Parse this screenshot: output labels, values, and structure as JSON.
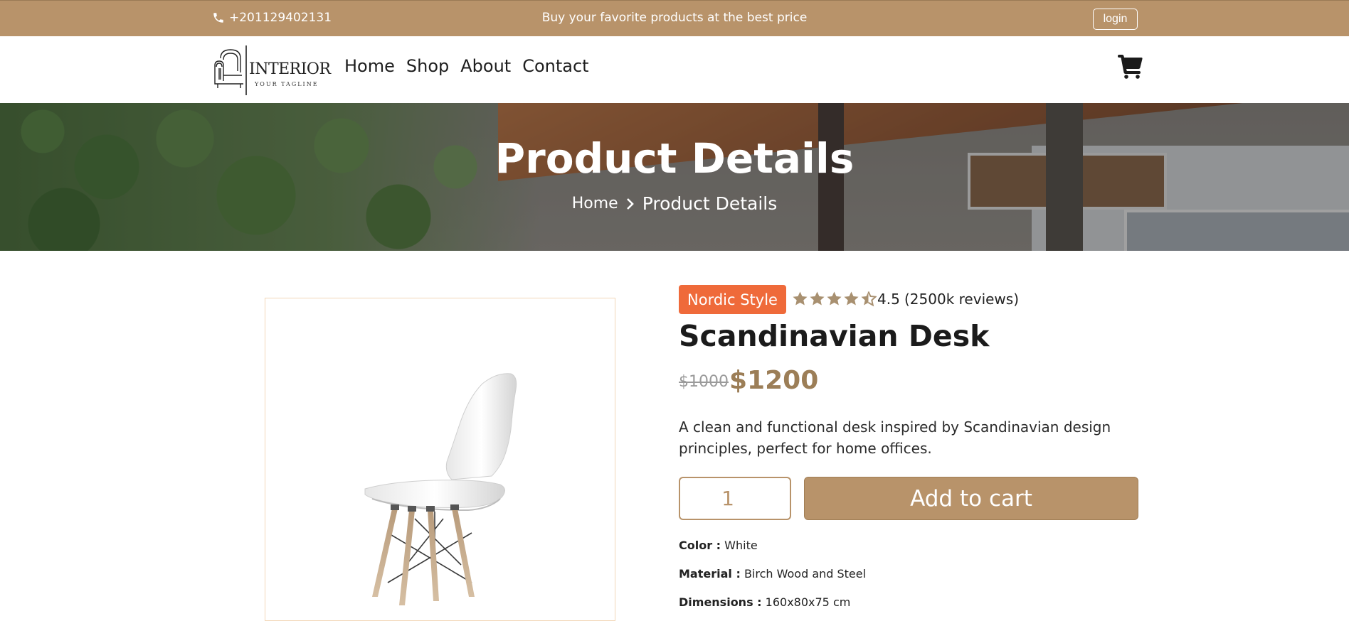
{
  "topbar": {
    "phone": "+201129402131",
    "promo": "Buy your favorite products at the best price",
    "login_label": "login",
    "phone_icon": "phone-icon"
  },
  "nav": {
    "logo": {
      "brand": "INTERIOR",
      "tagline": "YOUR TAGLINE"
    },
    "links": [
      "Home",
      "Shop",
      "About",
      "Contact"
    ],
    "cart_icon": "cart-icon"
  },
  "hero": {
    "title": "Product Details",
    "breadcrumb": {
      "home": "Home",
      "current": "Product Details"
    }
  },
  "product": {
    "badge": "Nordic Style",
    "rating": "4.5",
    "rating_value": 4.5,
    "rating_max": 5,
    "reviews": "(2500k reviews)",
    "name": "Scandinavian Desk",
    "old_price": "$1000",
    "price": "$1200",
    "description": "A clean and functional desk inspired by Scandinavian design principles, perfect for home offices.",
    "quantity": "1",
    "add_to_cart_label": "Add to cart",
    "specs": [
      {
        "label": "Color :",
        "value": "White"
      },
      {
        "label": "Material :",
        "value": "Birch Wood and Steel"
      },
      {
        "label": "Dimensions :",
        "value": "160x80x75 cm"
      }
    ]
  },
  "colors": {
    "brand": "#b8936a",
    "badge": "#ef6a3a",
    "price": "#9c7e57",
    "star": "#a89070",
    "image_border": "#f2d7b8"
  }
}
